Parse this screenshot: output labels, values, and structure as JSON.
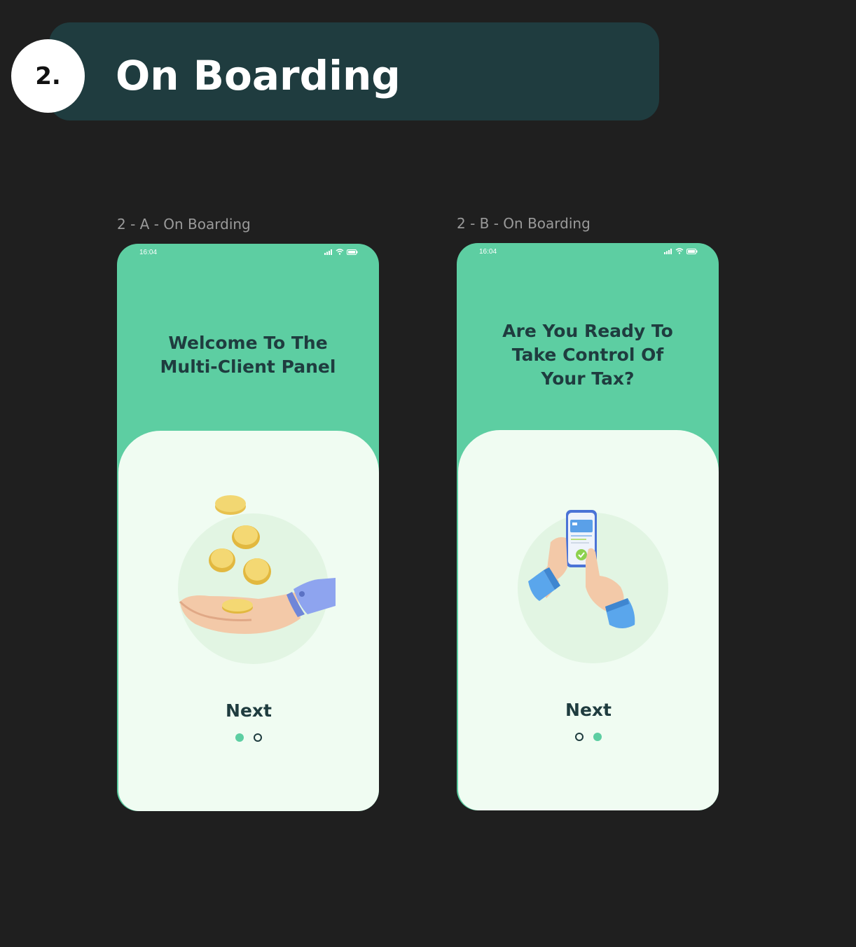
{
  "section": {
    "number": "2.",
    "title": "On Boarding",
    "banner_color": "#1f3c3f"
  },
  "screens": [
    {
      "label": "2 - A - On Boarding",
      "status_time": "16:04",
      "heading_lines": [
        "Welcome To The",
        "Multi-Client Panel"
      ],
      "illustration": "hand-with-coins-icon",
      "next_label": "Next",
      "dots": [
        "active",
        "inactive"
      ]
    },
    {
      "label": "2 - B - On Boarding",
      "status_time": "16:04",
      "heading_lines": [
        "Are You Ready To",
        "Take Control Of",
        "Your Tax?"
      ],
      "illustration": "hand-with-phone-icon",
      "next_label": "Next",
      "dots": [
        "inactive",
        "active"
      ]
    }
  ],
  "colors": {
    "accent": "#5dcea2",
    "card_bg": "#f0fcf2",
    "text_dark": "#1f3c3f",
    "page_bg": "#1f1f1f"
  }
}
